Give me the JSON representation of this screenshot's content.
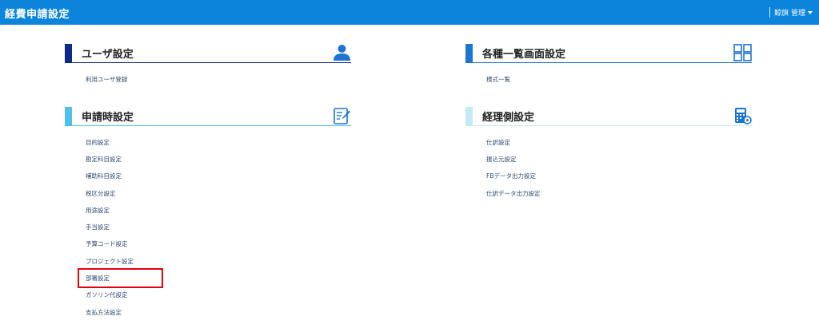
{
  "header": {
    "app_title": "経費申請設定",
    "user_label": "鯨旗 管理"
  },
  "colors": {
    "header_bg": "#0b84dc",
    "user_settings": "#0d2a8a",
    "application_settings": "#4fc0ea",
    "list_screen_settings": "#1c74d2",
    "accounting_settings": "#c3e9f6",
    "highlight": "#e60012"
  },
  "sections": {
    "user_settings": {
      "title": "ユーザ設定",
      "icon": "user-icon",
      "items": [
        "利用ユーザ登録"
      ]
    },
    "list_screen_settings": {
      "title": "各種一覧画面設定",
      "icon": "grid-icon",
      "items": [
        "様式一覧"
      ]
    },
    "application_settings": {
      "title": "申請時設定",
      "icon": "edit-document-icon",
      "items": [
        "目的設定",
        "勘定科目設定",
        "補助科目設定",
        "税区分設定",
        "用途設定",
        "手当設定",
        "予算コード設定",
        "プロジェクト設定",
        "部署設定",
        "ガソリン代設定",
        "支払方法設定"
      ]
    },
    "accounting_settings": {
      "title": "経理側設定",
      "icon": "calculator-icon",
      "items": [
        "仕訳設定",
        "振込元設定",
        "FBデータ出力設定",
        "仕訳データ出力設定"
      ]
    }
  }
}
